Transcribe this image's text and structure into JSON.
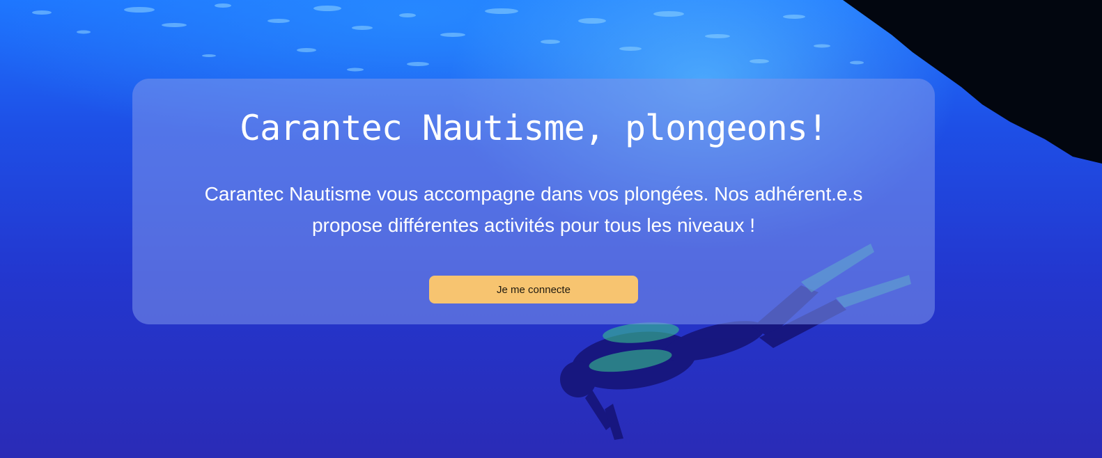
{
  "hero": {
    "title": "Carantec Nautisme, plongeons!",
    "description": "Carantec Nautisme vous accompagne dans vos plongées. Nos adhérent.e.s propose différentes activités pour tous les niveaux !",
    "cta_label": "Je me connecte",
    "background_image": "underwater-diver-photo"
  },
  "colors": {
    "water_top": "#1d74ff",
    "water_bottom": "#2a2bb6",
    "card_overlay": "#7d96eb",
    "button": "#f7c470",
    "text": "#ffffff"
  }
}
